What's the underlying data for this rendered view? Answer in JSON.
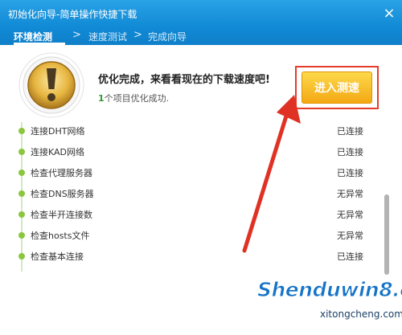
{
  "window": {
    "title": "初始化向导-简单操作快捷下载",
    "close_glyph": "×"
  },
  "steps": [
    {
      "label": "环境检测",
      "active": true
    },
    {
      "label": "速度测试",
      "active": false
    },
    {
      "label": "完成向导",
      "active": false
    }
  ],
  "step_arrow_glyph": ">",
  "result": {
    "headline": "优化完成，来看看现在的下载速度吧!",
    "count": "1",
    "subtext": "个项目优化成功."
  },
  "action": {
    "test_button_label": "进入测速"
  },
  "checks": [
    {
      "label": "连接DHT网络",
      "status": "已连接"
    },
    {
      "label": "连接KAD网络",
      "status": "已连接"
    },
    {
      "label": "检查代理服务器",
      "status": "已连接"
    },
    {
      "label": "检查DNS服务器",
      "status": "无异常"
    },
    {
      "label": "检查半开连接数",
      "status": "无异常"
    },
    {
      "label": "检查hosts文件",
      "status": "无异常"
    },
    {
      "label": "检查基本连接",
      "status": "已连接"
    }
  ],
  "watermark": {
    "brand": "Shenduwin8.com",
    "url": "xitongcheng.com"
  },
  "colors": {
    "titlebar_blue": "#1a93dc",
    "button_orange": "#f4a814",
    "highlight_red": "#e53c2a",
    "timeline_green": "#8cc63f"
  },
  "icons": {
    "status": "exclamation-badge-icon",
    "close": "close-icon",
    "pointer": "red-pointer-arrow-icon"
  }
}
